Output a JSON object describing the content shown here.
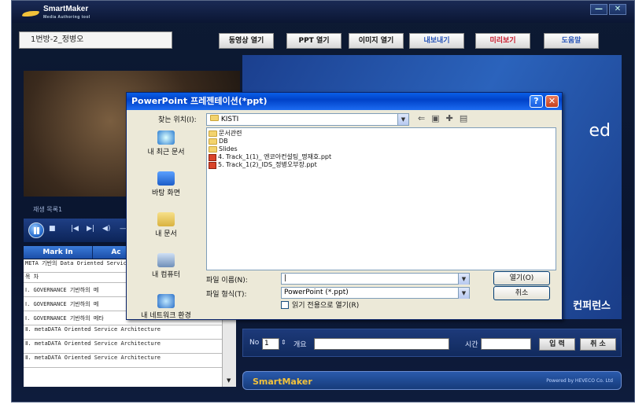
{
  "app": {
    "logo_text": "SmartMaker",
    "logo_sub": "Media Authoring tool",
    "title_value": "1번방-2_정병오",
    "window_buttons": [
      "—",
      "✕"
    ]
  },
  "toolbar": {
    "video_open": "동영상 열기",
    "ppt_open": "PPT 열기",
    "image_open": "이미지 열기",
    "export": "내보내기",
    "preview": "미리보기",
    "help": "도움말"
  },
  "player": {
    "playlist_label": "재생 목록1",
    "controls": [
      "■",
      "|◀",
      "▶|",
      "◀)",
      "—"
    ],
    "mark_in": "Mark In",
    "mark_ac": "Ac"
  },
  "list_items": [
    "META 기반의 Data Oriented Service Architecture",
    "목 차",
    "Ⅰ. GOVERNANCE 기반하의 메",
    "Ⅰ. GOVERNANCE 기반하의 메",
    "Ⅰ. GOVERNANCE 기반하의 메타",
    "Ⅱ. metaDATA Oriented Service Architecture",
    "Ⅱ. metaDATA Oriented Service Architecture",
    "Ⅱ. metaDATA Oriented Service Architecture"
  ],
  "slide": {
    "text_fragment": "ed",
    "conference": "컨퍼런스"
  },
  "input_row": {
    "no_label": "No",
    "no_value": "1",
    "summary_label": "개요",
    "time_label": "시간",
    "input_button": "입 력",
    "cancel_button": "취 소"
  },
  "footer": {
    "logo": "SmartMaker",
    "powered": "Powered by HEVECO Co. Ltd"
  },
  "dialog": {
    "title": "PowerPoint 프레젠테이션(*ppt)",
    "help_btn": "?",
    "close_btn": "✕",
    "look_in_label": "찾는 위치(I):",
    "look_in_value": "KISTI",
    "places": [
      "내 최근 문서",
      "바탕 화면",
      "내 문서",
      "내 컴퓨터",
      "내 네트워크 환경"
    ],
    "files": [
      {
        "type": "folder",
        "name": "문서관련"
      },
      {
        "type": "folder",
        "name": "DB"
      },
      {
        "type": "folder",
        "name": "Slides"
      },
      {
        "type": "ppt",
        "name": "4. Track_1(1)_ 엔코아컨설팅_명재호.ppt"
      },
      {
        "type": "ppt",
        "name": "5. Track_1(2)_IDS_정병오부장.ppt"
      }
    ],
    "filename_label": "파일 이름(N):",
    "filename_value": "|",
    "filetype_label": "파일 형식(T):",
    "filetype_value": "PowerPoint (*.ppt)",
    "readonly_label": "읽기 전용으로 열기(R)",
    "open_button": "열기(O)",
    "cancel_button": "취소"
  },
  "colors": {
    "app_bg": "#0d1a33",
    "dialog_title": "#0a5fe8",
    "export_text": "#2553b8",
    "preview_text": "#c8192b"
  }
}
